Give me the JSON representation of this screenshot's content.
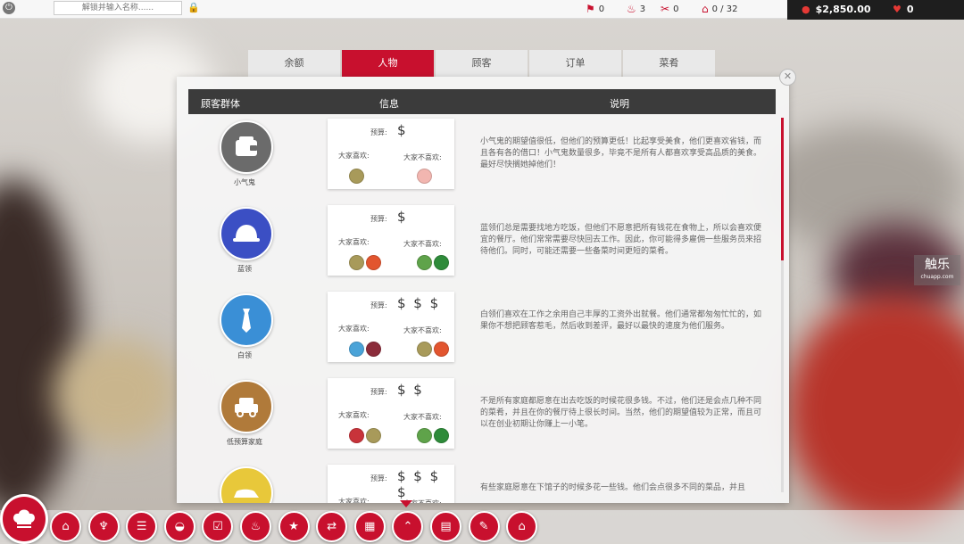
{
  "topbar": {
    "name_placeholder": "解锁并输入名称......",
    "stats": [
      {
        "icon": "flag-icon",
        "value": "0"
      },
      {
        "icon": "chef-hat-icon",
        "value": "3"
      },
      {
        "icon": "utensils-icon",
        "value": "0"
      },
      {
        "icon": "building-icon",
        "value": "0 / 32"
      }
    ],
    "money": "$2,850.00",
    "hearts": "0"
  },
  "tabs": [
    {
      "label": "余额",
      "active": false
    },
    {
      "label": "人物",
      "active": true
    },
    {
      "label": "顾客",
      "active": false
    },
    {
      "label": "订单",
      "active": false
    },
    {
      "label": "菜肴",
      "active": false
    }
  ],
  "table": {
    "col_group": "顾客群体",
    "col_info": "信息",
    "col_desc": "说明",
    "budget_label": "预算:",
    "like_label": "大家喜欢:",
    "dislike_label": "大家不喜欢:",
    "rows": [
      {
        "name": "小气鬼",
        "avatar_icon": "wallet-icon",
        "avatar_color": "#6b6b6b",
        "budget": "$",
        "likes": [
          "#a89a5a"
        ],
        "dislikes": [
          "#f2b6b0"
        ],
        "desc": "小气鬼的期望值很低，但他们的预算更低！比起享受美食，他们更喜欢省钱，而且各有各的借口！小气鬼数量很多，毕竟不是所有人都喜欢享受高品质的美食。最好尽快搁她掉他们！"
      },
      {
        "name": "蓝领",
        "avatar_icon": "hard-hat-icon",
        "avatar_color": "#3b4fc4",
        "budget": "$",
        "likes": [
          "#a89a5a",
          "#e2552f"
        ],
        "dislikes": [
          "#5fa34a",
          "#2e8b3a"
        ],
        "desc": "蓝领们总是需要找地方吃饭，但他们不愿意把所有钱花在食物上，所以会喜欢便宜的餐厅。他们常常需要尽快回去工作。因此，你可能得多雇佣一些服务员来招待他们。同时，可能还需要一些备菜时间更短的菜肴。"
      },
      {
        "name": "白领",
        "avatar_icon": "necktie-icon",
        "avatar_color": "#3a8fd6",
        "budget": "$ $ $",
        "likes": [
          "#4aa3d8",
          "#8b2c3a"
        ],
        "dislikes": [
          "#a89a5a",
          "#e2552f"
        ],
        "desc": "白领们喜欢在工作之余用自己丰厚的工资外出就餐。他们通常都匆匆忙忙的，如果你不想把顾客惹毛，然后收到差评，最好以最快的速度为他们服务。"
      },
      {
        "name": "低预算家庭",
        "avatar_icon": "car-icon",
        "avatar_color": "#b07a3a",
        "budget": "$ $",
        "likes": [
          "#c8333a",
          "#a89a5a"
        ],
        "dislikes": [
          "#5fa34a",
          "#2e8b3a"
        ],
        "desc": "不是所有家庭都愿意在出去吃饭的时候花很多钱。不过，他们还是会点几种不同的菜肴，并且在你的餐厅待上很长时间。当然，他们的期望值较为正常，而且可以在创业初期让你赚上一小笔。"
      },
      {
        "name": "",
        "avatar_icon": "sedan-icon",
        "avatar_color": "#e8c83a",
        "budget": "$ $ $ $",
        "likes": [],
        "dislikes": [],
        "desc": "有些家庭愿意在下馆子的时候多花一些钱。他们会点很多不同的菜品，并且"
      }
    ]
  },
  "watermark": {
    "main": "触乐",
    "sub": "chuapp.com"
  },
  "bottom_icons": [
    "garage-icon",
    "tooth-icon",
    "menu-icon",
    "bowl-icon",
    "checklist-icon",
    "dish-icon",
    "star-icon",
    "toggle-icon",
    "building-icon",
    "chart-icon",
    "calendar-icon",
    "document-icon",
    "store-icon"
  ],
  "colors": {
    "accent": "#c8102e"
  }
}
